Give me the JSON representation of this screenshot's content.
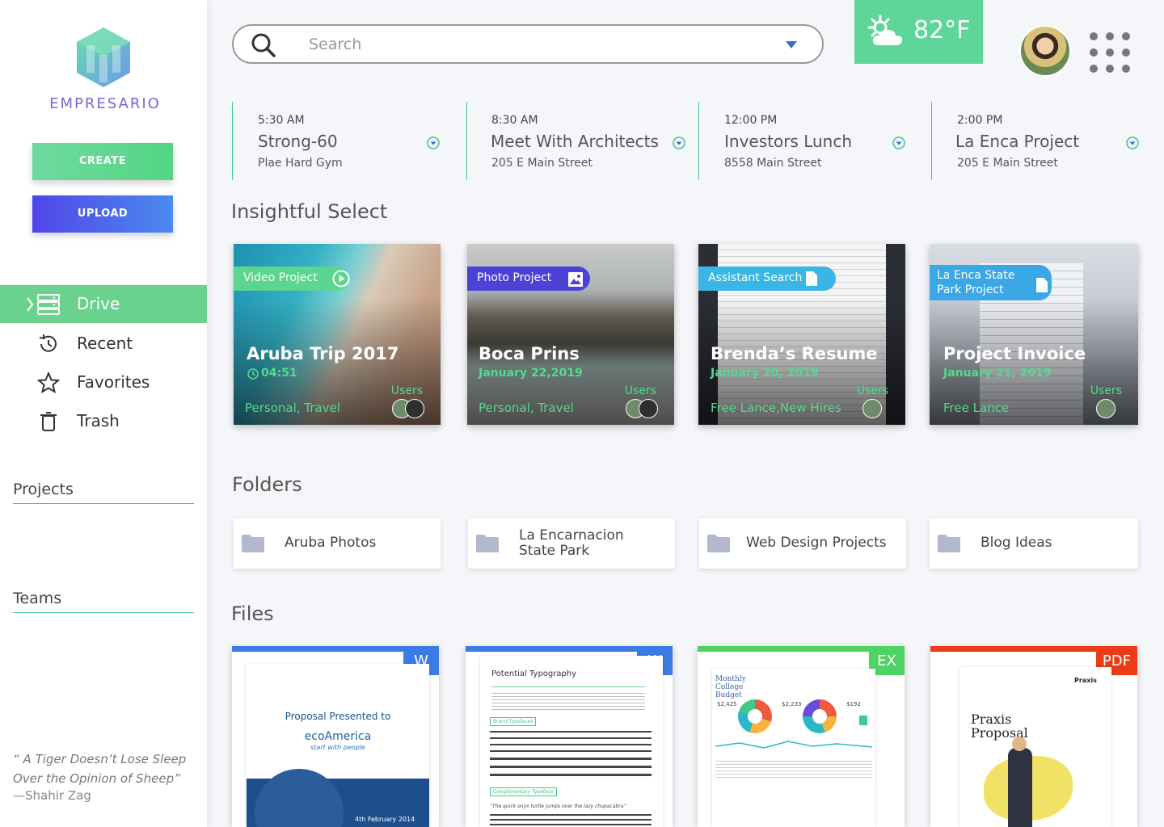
{
  "brand": {
    "name": "EMPRESARIO"
  },
  "actions": {
    "create": "CREATE",
    "upload": "UPLOAD"
  },
  "nav": [
    {
      "label": "Drive",
      "icon": "drive-icon",
      "active": true
    },
    {
      "label": "Recent",
      "icon": "history-icon"
    },
    {
      "label": "Favorites",
      "icon": "star-icon"
    },
    {
      "label": "Trash",
      "icon": "trash-icon"
    }
  ],
  "sections": {
    "projects": "Projects",
    "teams": "Teams"
  },
  "quote": {
    "text": "“ A Tiger Doesn’t Lose Sleep Over the Opinion of Sheep”",
    "author": "—Shahir Zag"
  },
  "search": {
    "placeholder": "Search"
  },
  "weather": {
    "temperature": "82°F",
    "icon": "partly-cloudy-icon"
  },
  "events": [
    {
      "time": "5:30 AM",
      "title": "Strong-60",
      "location": "Plae Hard Gym"
    },
    {
      "time": "8:30 AM",
      "title": "Meet With Architects",
      "location": "205 E Main Street"
    },
    {
      "time": "12:00 PM",
      "title": "Investors Lunch",
      "location": "8558 Main Street"
    },
    {
      "time": "2:00 PM",
      "title": "La Enca Project",
      "location": "205 E Main Street"
    }
  ],
  "headings": {
    "insightful": "Insightful Select",
    "folders": "Folders",
    "files": "Files"
  },
  "cards": [
    {
      "tag": "Video Project",
      "tag_color": "#5bd58f",
      "title": "Aruba Trip 2017",
      "date": "04:51",
      "tags": "Personal, Travel",
      "users": "Users"
    },
    {
      "tag": "Photo Project",
      "tag_color": "#4c43d6",
      "title": "Boca Prins",
      "date": "January 22,2019",
      "tags": "Personal, Travel",
      "users": "Users"
    },
    {
      "tag": "Assistant Search",
      "tag_color": "#39b6e6",
      "title": "Brenda’s Resume",
      "date": "January 20, 2019",
      "tags": "Free Lance,New Hires",
      "users": "Users"
    },
    {
      "tag": "La Enca State Park Project",
      "tag_line1": "La Enca State",
      "tag_line2": "Park Project",
      "tag_color": "#3aa7e6",
      "title": "Project Invoice",
      "date": "January 21, 2019",
      "tags": "Free Lance",
      "users": "Users"
    }
  ],
  "folders": [
    {
      "name": "Aruba Photos"
    },
    {
      "name": "La Encarnacion State Park",
      "line1": "La Encarnacion",
      "line2": "State Park"
    },
    {
      "name": "Web Design Projects"
    },
    {
      "name": "Blog Ideas"
    }
  ],
  "files": [
    {
      "type": "W",
      "color": "#3a7be6",
      "preview_title": "Proposal Presented to",
      "preview_brand": "ecoAmerica",
      "preview_sub": "start with people",
      "preview_date": "4th February 2014"
    },
    {
      "type": "W",
      "color": "#3a7be6",
      "preview_title": "Potential Typography",
      "preview_brand": "Brand Typefaces",
      "preview_sub": "Complimentary Typeface",
      "preview_date": "“The quick onyx turtle jumps over the lazy chupacabra”"
    },
    {
      "type": "EX",
      "color": "#4fd364",
      "preview_title": "Monthly College Budget",
      "preview_brand": "$2,425",
      "preview_sub": "$2,233",
      "preview_date": "$192"
    },
    {
      "type": "PDF",
      "color": "#ec3b17",
      "preview_title": "Praxis Proposal",
      "preview_brand": "Praxis"
    }
  ]
}
